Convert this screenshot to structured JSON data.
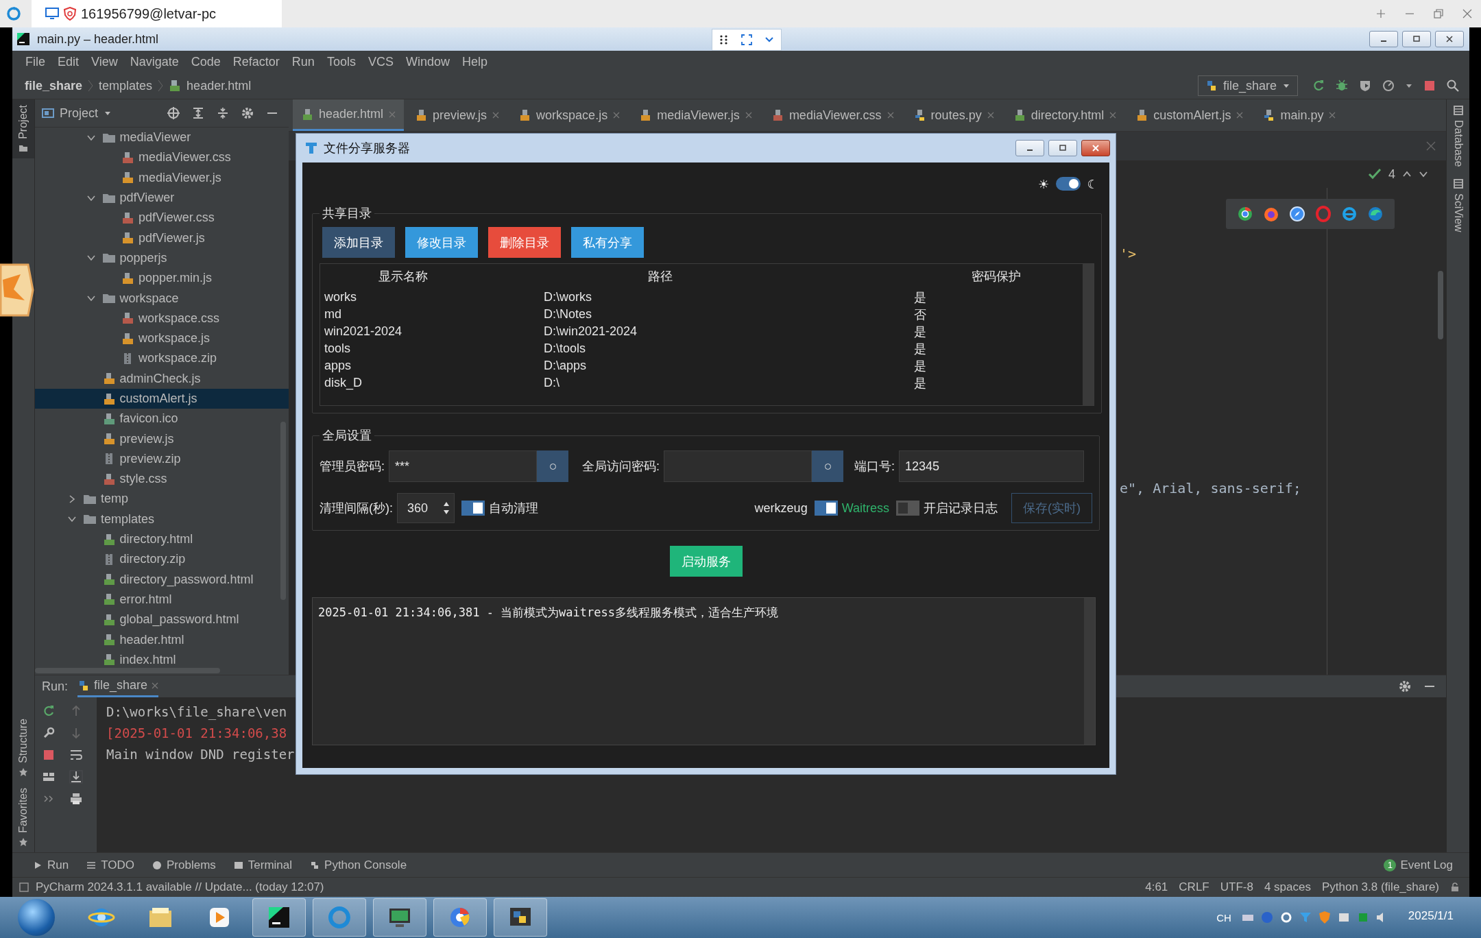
{
  "remote_bar": {
    "tab_title": "161956799@letvar-pc"
  },
  "ide": {
    "title": "main.py – header.html",
    "menu": [
      "File",
      "Edit",
      "View",
      "Navigate",
      "Code",
      "Refactor",
      "Run",
      "Tools",
      "VCS",
      "Window",
      "Help"
    ],
    "breadcrumb": [
      "file_share",
      "templates",
      "header.html"
    ],
    "run_config": "file_share",
    "left_strip": {
      "top": {
        "label": "Project",
        "selected": true
      },
      "bottom": [
        {
          "label": "Structure",
          "selected": false
        },
        {
          "label": "Favorites",
          "selected": false
        }
      ]
    },
    "right_strip": [
      "Database",
      "SciView"
    ],
    "project_panel": {
      "title": "Project",
      "tree": [
        {
          "children": [
            {
              "label": "mediaViewer",
              "kind": "folder",
              "expanded": true,
              "selected": false,
              "children": [
                {
                  "label": "mediaViewer.css",
                  "kind": "css",
                  "selected": false
                },
                {
                  "label": "mediaViewer.js",
                  "kind": "js",
                  "selected": false
                }
              ]
            },
            {
              "label": "pdfViewer",
              "kind": "folder",
              "expanded": true,
              "selected": false,
              "children": [
                {
                  "label": "pdfViewer.css",
                  "kind": "css",
                  "selected": false
                },
                {
                  "label": "pdfViewer.js",
                  "kind": "js",
                  "selected": false
                }
              ]
            },
            {
              "label": "popperjs",
              "kind": "folder",
              "expanded": true,
              "selected": false,
              "children": [
                {
                  "label": "popper.min.js",
                  "kind": "minjs",
                  "selected": false
                }
              ]
            },
            {
              "label": "workspace",
              "kind": "folder",
              "expanded": true,
              "selected": false,
              "children": [
                {
                  "label": "workspace.css",
                  "kind": "css",
                  "selected": false
                },
                {
                  "label": "workspace.js",
                  "kind": "js",
                  "selected": false
                },
                {
                  "label": "workspace.zip",
                  "kind": "zip",
                  "selected": false
                }
              ]
            },
            {
              "label": "adminCheck.js",
              "kind": "js",
              "selected": false
            },
            {
              "label": "customAlert.js",
              "kind": "js",
              "selected": true
            },
            {
              "label": "favicon.ico",
              "kind": "ico",
              "selected": false
            },
            {
              "label": "preview.js",
              "kind": "js",
              "selected": false
            },
            {
              "label": "preview.zip",
              "kind": "zip",
              "selected": false
            },
            {
              "label": "style.css",
              "kind": "css",
              "selected": false
            }
          ]
        },
        {
          "label": "temp",
          "kind": "folder",
          "expanded": false,
          "selected": false
        },
        {
          "label": "templates",
          "kind": "folder",
          "expanded": true,
          "selected": false,
          "children": [
            {
              "label": "directory.html",
              "kind": "html",
              "selected": false
            },
            {
              "label": "directory.zip",
              "kind": "zip",
              "selected": false
            },
            {
              "label": "directory_password.html",
              "kind": "html",
              "selected": false
            },
            {
              "label": "error.html",
              "kind": "html",
              "selected": false
            },
            {
              "label": "global_password.html",
              "kind": "html",
              "selected": false
            },
            {
              "label": "header.html",
              "kind": "html",
              "selected": false
            },
            {
              "label": "index.html",
              "kind": "html",
              "selected": false
            }
          ]
        }
      ]
    },
    "editor_tabs": [
      {
        "label": "header.html",
        "kind": "html",
        "selected": true
      },
      {
        "label": "preview.js",
        "kind": "js",
        "selected": false
      },
      {
        "label": "workspace.js",
        "kind": "js",
        "selected": false
      },
      {
        "label": "mediaViewer.js",
        "kind": "js",
        "selected": false
      },
      {
        "label": "mediaViewer.css",
        "kind": "css",
        "selected": false
      },
      {
        "label": "routes.py",
        "kind": "py",
        "selected": false
      },
      {
        "label": "directory.html",
        "kind": "html",
        "selected": false
      },
      {
        "label": "customAlert.js",
        "kind": "js",
        "selected": false
      },
      {
        "label": "main.py",
        "kind": "py",
        "selected": false
      }
    ],
    "inspection_count": "4",
    "code_lines": [
      "'>",
      "e\", Arial, sans-serif;"
    ],
    "run_panel": {
      "label": "Run:",
      "tab": "file_share",
      "lines": [
        {
          "text": "D:\\works\\file_share\\ven",
          "kind": "normal"
        },
        {
          "text": "[2025-01-01 21:34:06,38",
          "kind": "error"
        },
        {
          "text": "Main window DND register",
          "kind": "normal"
        }
      ]
    },
    "bottom_tools": [
      {
        "label": "Run",
        "kind": "run"
      },
      {
        "label": "TODO",
        "kind": "todo"
      },
      {
        "label": "Problems",
        "kind": "problems"
      },
      {
        "label": "Terminal",
        "kind": "terminal"
      },
      {
        "label": "Python Console",
        "kind": "python"
      }
    ],
    "event_log": {
      "count": "1",
      "label": "Event Log"
    },
    "status": {
      "message": "PyCharm 2024.3.1.1 available // Update... (today 12:07)",
      "items": [
        "4:61",
        "CRLF",
        "UTF-8",
        "4 spaces",
        "Python 3.8 (file_share)"
      ]
    }
  },
  "dialog": {
    "title": "文件分享服务器",
    "theme_toggle": {
      "sun": "☀",
      "moon": "☾",
      "on": true
    },
    "shared_dirs": {
      "legend": "共享目录",
      "buttons": [
        {
          "label": "添加目录",
          "color": "#34506e"
        },
        {
          "label": "修改目录",
          "color": "#3498db"
        },
        {
          "label": "删除目录",
          "color": "#e74c3c"
        },
        {
          "label": "私有分享",
          "color": "#3498db"
        }
      ],
      "columns": [
        "显示名称",
        "路径",
        "密码保护"
      ],
      "rows": [
        [
          "works",
          "D:\\works",
          "是"
        ],
        [
          "md",
          "D:\\Notes",
          "否"
        ],
        [
          "win2021-2024",
          "D:\\win2021-2024",
          "是"
        ],
        [
          "tools",
          "D:\\tools",
          "是"
        ],
        [
          "apps",
          "D:\\apps",
          "是"
        ],
        [
          "disk_D",
          "D:\\",
          "是"
        ]
      ]
    },
    "settings": {
      "legend": "全局设置",
      "admin_password": {
        "label": "管理员密码:",
        "value": "***"
      },
      "access_password": {
        "label": "全局访问密码:"
      },
      "port": {
        "label": "端口号:",
        "value": "12345"
      },
      "cleanup_interval": {
        "label": "清理间隔(秒):",
        "value": "360"
      },
      "auto_clean": {
        "label": "自动清理",
        "on": true
      },
      "server": {
        "left": "werkzeug",
        "right": "Waitress",
        "on": true
      },
      "logging": {
        "label": "开启记录日志",
        "on": false
      },
      "save_button": {
        "label": "保存(实时)",
        "disabled": true
      }
    },
    "start_button": "启动服务",
    "log": [
      "2025-01-01 21:34:06,381 - 当前模式为waitress多线程服务模式，适合生产环境"
    ]
  },
  "taskbar": {
    "language": "CH",
    "date": "2025/1/1"
  }
}
